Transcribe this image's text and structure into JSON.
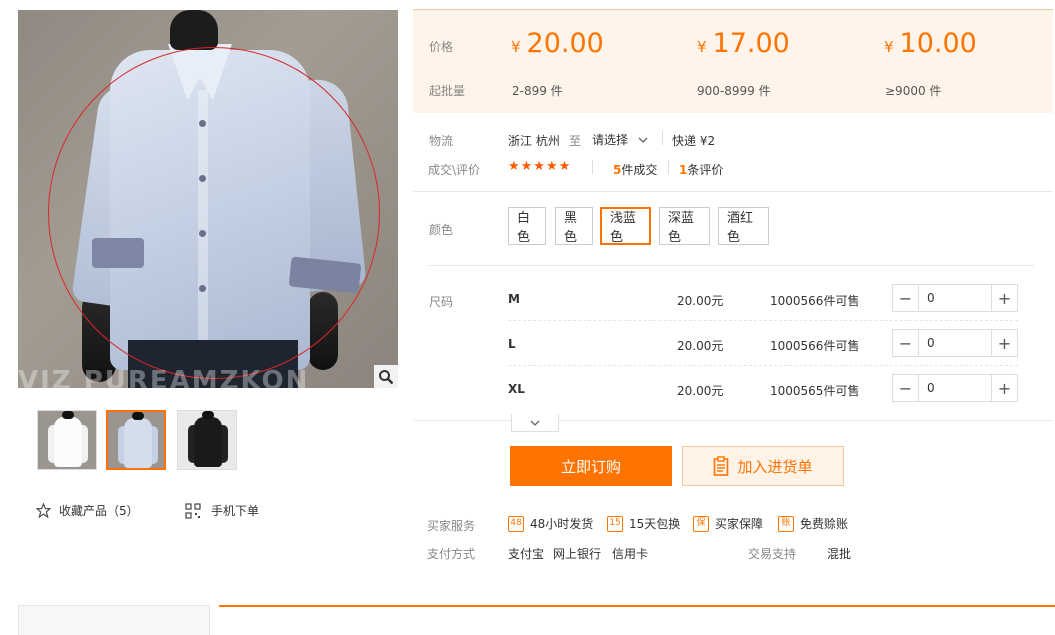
{
  "gallery": {
    "watermark": "VIZ PUREAMZKON",
    "thumbnails": [
      {
        "color": "#ffffff",
        "active": false
      },
      {
        "color": "#c9d6ea",
        "active": true
      },
      {
        "color": "#1a1a1a",
        "active": false
      }
    ],
    "favorite_label": "收藏产品（5）",
    "mobile_label": "手机下单"
  },
  "price_box": {
    "price_label": "价格",
    "moq_label": "起批量",
    "tiers": [
      {
        "currency": "¥",
        "price": "20.00",
        "range": "2-899 件"
      },
      {
        "currency": "¥",
        "price": "17.00",
        "range": "900-8999 件"
      },
      {
        "currency": "¥",
        "price": "10.00",
        "range": "≥9000 件"
      }
    ]
  },
  "logistics": {
    "label": "物流",
    "origin": "浙江 杭州",
    "to": "至",
    "destination_select": "请选择",
    "shipping": "快递 ¥2"
  },
  "reviews": {
    "label": "成交\\评价",
    "stars": "★★★★★",
    "deals_count": "5",
    "deals_suffix": "件成交",
    "review_count": "1",
    "review_suffix": "条评价"
  },
  "colors": {
    "label": "颜色",
    "options": [
      "白色",
      "黑色",
      "浅蓝色",
      "深蓝色",
      "酒红色"
    ],
    "selected": "浅蓝色"
  },
  "sizes": {
    "label": "尺码",
    "rows": [
      {
        "name": "M",
        "price": "20.00元",
        "stock": "1000566件可售",
        "qty": "0"
      },
      {
        "name": "L",
        "price": "20.00元",
        "stock": "1000566件可售",
        "qty": "0"
      },
      {
        "name": "XL",
        "price": "20.00元",
        "stock": "1000565件可售",
        "qty": "0"
      }
    ]
  },
  "actions": {
    "order_label": "立即订购",
    "cart_label": "加入进货单"
  },
  "services": {
    "label": "买家服务",
    "items": [
      {
        "icon": "48",
        "label": "48小时发货"
      },
      {
        "icon": "15",
        "label": "15天包换"
      },
      {
        "icon": "保",
        "label": "买家保障"
      },
      {
        "icon": "账",
        "label": "免费赊账"
      }
    ]
  },
  "payment": {
    "label": "支付方式",
    "methods": [
      "支付宝",
      "网上银行",
      "信用卡"
    ],
    "trade_support_label": "交易支持",
    "trade_support_value": "混批"
  },
  "theme": {
    "accent": "#ff7300",
    "price_bg": "#fff4ea"
  }
}
